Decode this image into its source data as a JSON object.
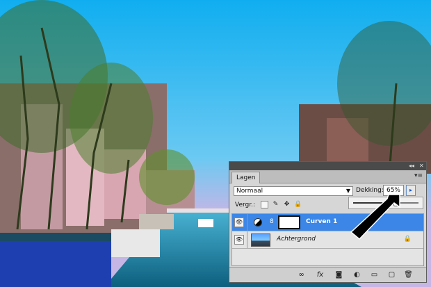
{
  "photo": {
    "description_icon": "amsterdam-canal-photo",
    "sky_color": "#2fb6f2",
    "water_color": "#1e8fb8"
  },
  "panel": {
    "tab_label": "Lagen",
    "topbar_controls": [
      "◂◂",
      "✕"
    ],
    "menu_icon": "panel-menu-icon",
    "blend_mode": "Normaal",
    "opacity_label": "Dekking:",
    "opacity_value": "65%",
    "opacity_fraction": 0.65,
    "lock_label": "Vergr.:",
    "lock_icons": [
      "lock-transparent-icon",
      "lock-paint-icon",
      "lock-move-icon",
      "lock-all-icon"
    ],
    "layers": [
      {
        "name": "Curven 1",
        "selected": true,
        "type": "adjustment"
      },
      {
        "name": "Achtergrond",
        "selected": false,
        "type": "image",
        "locked": true
      }
    ],
    "footer_icons": [
      "link-icon",
      "fx-icon",
      "mask-icon",
      "adjustment-icon",
      "group-icon",
      "new-layer-icon",
      "trash-icon"
    ],
    "footer_glyphs": [
      "∞",
      "fx",
      "◙",
      "◐",
      "▭",
      "▢",
      "🗑"
    ],
    "accent": "#3b86e6"
  }
}
